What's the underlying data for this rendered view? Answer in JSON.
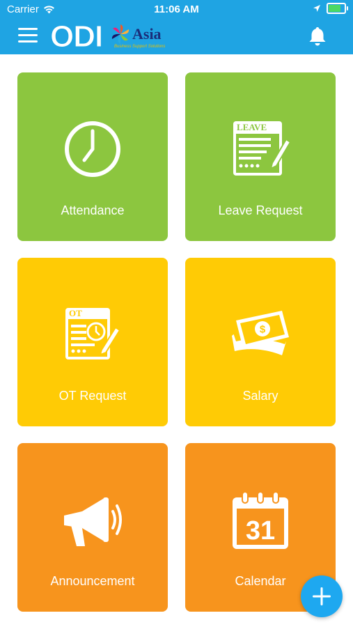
{
  "status_bar": {
    "carrier": "Carrier",
    "time": "11:06 AM",
    "battery_level": 0.85
  },
  "header": {
    "logo_text": "ODI",
    "logo_suffix": "Asia",
    "logo_tagline": "Business Support Solutions",
    "menu_icon": "hamburger-menu-icon",
    "notification_icon": "bell-icon"
  },
  "colors": {
    "header": "#1fa4e3",
    "green": "#8cc63f",
    "yellow": "#ffcb05",
    "orange": "#f7941d",
    "fab": "#1ea8f0"
  },
  "tiles": [
    {
      "label": "Attendance",
      "icon": "clock-icon",
      "color": "#8cc63f"
    },
    {
      "label": "Leave Request",
      "icon": "leave-form-icon",
      "icon_text": "LEAVE",
      "color": "#8cc63f"
    },
    {
      "label": "OT Request",
      "icon": "ot-form-icon",
      "icon_text": "OT",
      "color": "#ffcb05"
    },
    {
      "label": "Salary",
      "icon": "money-icon",
      "color": "#ffcb05"
    },
    {
      "label": "Announcement",
      "icon": "megaphone-icon",
      "color": "#f7941d"
    },
    {
      "label": "Calendar",
      "icon": "calendar-icon",
      "icon_text": "31",
      "color": "#f7941d"
    }
  ],
  "fab": {
    "icon": "plus-icon"
  }
}
